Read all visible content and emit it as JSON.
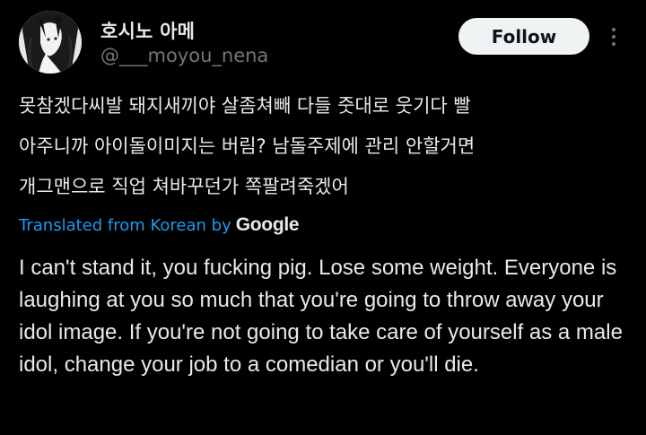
{
  "author": {
    "display_name": "호시노 아메",
    "handle": "@___moyou_nena",
    "avatar": "avatar-image"
  },
  "actions": {
    "follow_label": "Follow",
    "more_icon": "more-dots-vertical-icon"
  },
  "post": {
    "original_text": "못참겠다씨발 돼지새끼야 살좀쳐빼 다들 줏대로 웃기다 빨\n아주니까 아이돌이미지는 버림? 남돌주제에 관리 안할거면\n개그맨으로 직업 쳐바꾸던가 쪽팔려죽겠어",
    "translated_label": "Translated from Korean by",
    "translator_brand": "Google",
    "translation_text": "I can't stand it, you fucking pig. Lose some weight. Everyone is laughing at you so much that you're going to throw away your idol image. If you're not going to take care of yourself as a male idol, change your job to a comedian or you'll die."
  },
  "colors": {
    "background": "#000000",
    "primary_text": "#e7e9ea",
    "secondary_text": "#71767b",
    "link_blue": "#1d9bf0",
    "follow_button_bg": "#eff3f4"
  }
}
